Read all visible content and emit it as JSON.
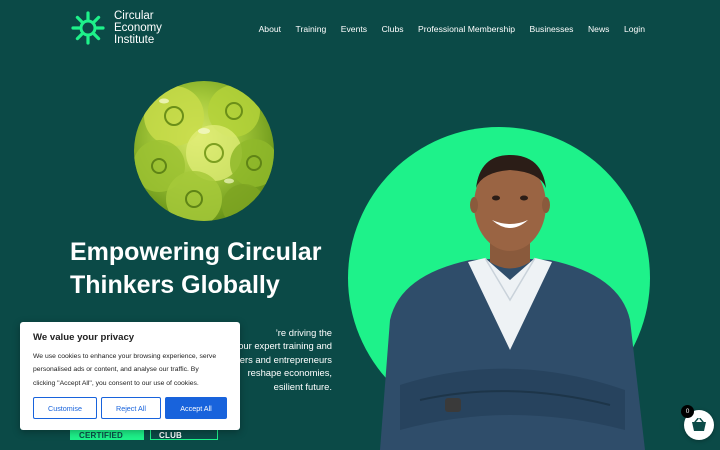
{
  "brand": {
    "logo_line1": "Circular",
    "logo_line2": "Economy",
    "logo_line3": "Institute",
    "accent_color": "#1ef28a",
    "background_color": "#0b4a47"
  },
  "nav": {
    "items": [
      {
        "label": "About"
      },
      {
        "label": "Training"
      },
      {
        "label": "Events"
      },
      {
        "label": "Clubs"
      },
      {
        "label": "Professional Membership"
      },
      {
        "label": "Businesses"
      },
      {
        "label": "News"
      },
      {
        "label": "Login"
      }
    ]
  },
  "hero": {
    "headline_line1": "Empowering Circular",
    "headline_line2": "Thinkers Globally",
    "intro_line1": "’re driving the",
    "intro_line2": "our expert training and",
    "intro_line3": "ers and entrepreneurs",
    "intro_line4": "reshape economies,",
    "intro_line5": "esilient future.",
    "cta_primary": "GET CERTIFIED",
    "cta_secondary": "JOIN A CLUB"
  },
  "cookie_banner": {
    "title": "We value your privacy",
    "body_line1": "We use cookies to enhance your browsing experience, serve",
    "body_line2": "personalised ads or content, and analyse our traffic. By",
    "body_line3": "clicking \"Accept All\", you consent to our use of cookies.",
    "customise_label": "Customise",
    "reject_label": "Reject All",
    "accept_label": "Accept All",
    "button_color": "#1863dc"
  },
  "cart": {
    "count": "0",
    "icon": "basket-icon"
  }
}
